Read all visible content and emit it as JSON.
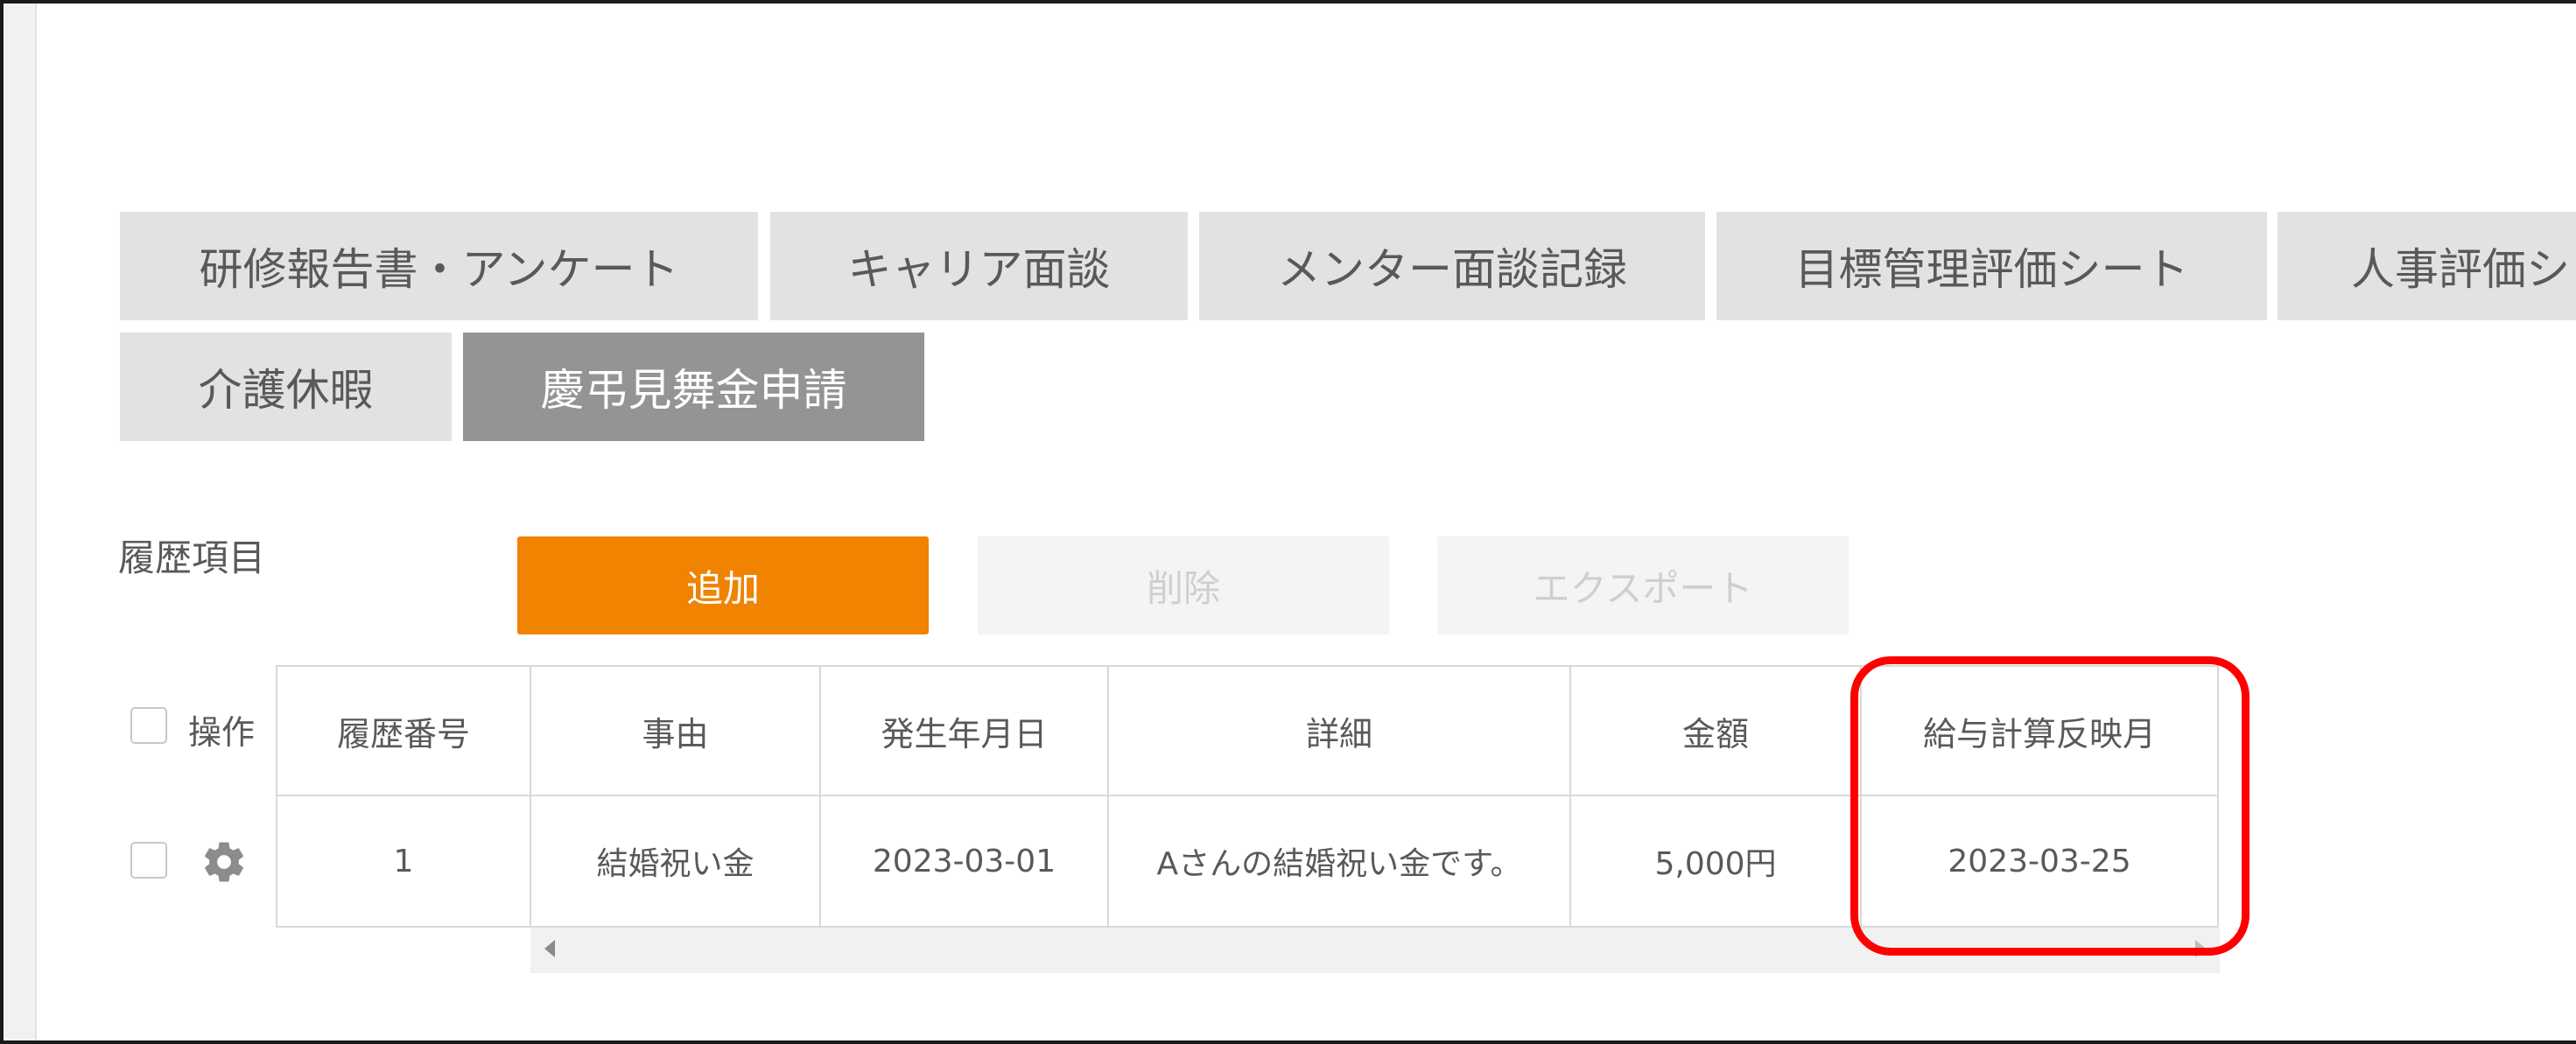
{
  "tabs_row1": [
    {
      "label": "研修報告書・アンケート"
    },
    {
      "label": "キャリア面談"
    },
    {
      "label": "メンター面談記録"
    },
    {
      "label": "目標管理評価シート"
    },
    {
      "label": "人事評価シ"
    }
  ],
  "tabs_row2": [
    {
      "label": "介護休暇"
    },
    {
      "label": "慶弔見舞金申請",
      "active": true
    }
  ],
  "section": {
    "label": "履歴項目"
  },
  "actions": {
    "add_label": "追加",
    "delete_label": "削除",
    "export_label": "エクスポート"
  },
  "table": {
    "op_header": "操作",
    "columns": [
      "履歴番号",
      "事由",
      "発生年月日",
      "詳細",
      "金額",
      "給与計算反映月"
    ],
    "rows": [
      [
        "1",
        "結婚祝い金",
        "2023-03-01",
        "Aさんの結婚祝い金です。",
        "5,000円",
        "2023-03-25"
      ]
    ]
  },
  "colors": {
    "accent": "#f08300",
    "active_tab": "#949494",
    "inactive_tab": "#e2e2e2",
    "highlight": "#ff0000"
  },
  "icons": {
    "row_settings": "gear-icon",
    "scroll_left": "chevron-left-icon",
    "scroll_right": "chevron-right-icon"
  }
}
